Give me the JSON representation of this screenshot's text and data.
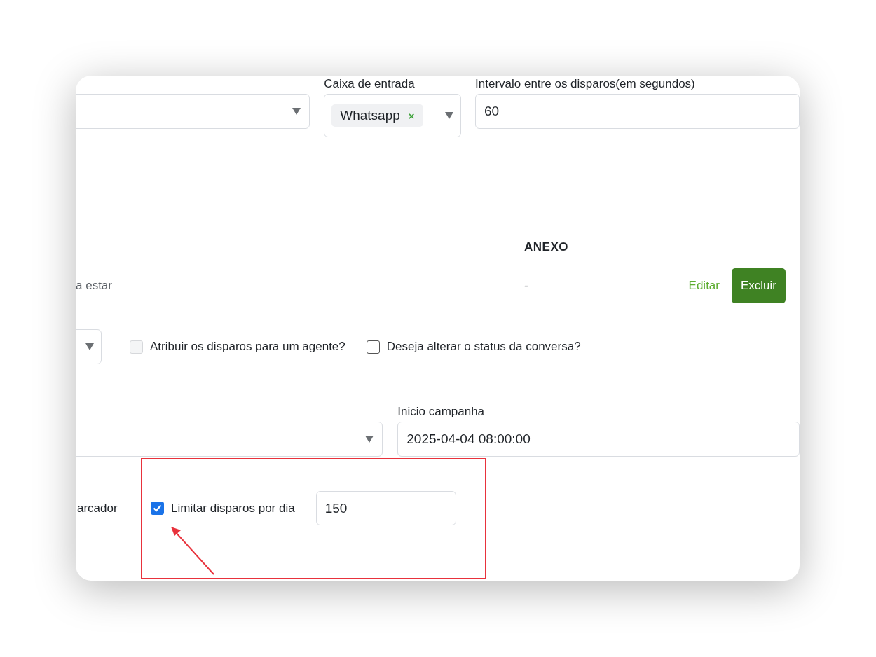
{
  "inbox": {
    "label": "Caixa de entrada",
    "tags": [
      {
        "label": "Whatsapp",
        "remove": "×"
      }
    ]
  },
  "interval": {
    "label": "Intervalo entre os disparos(em segundos)",
    "value": "60"
  },
  "table": {
    "columns": [
      "ANEXO"
    ],
    "rows": [
      {
        "column_1": "a estar",
        "anexo": "-",
        "actions": [
          "Editar",
          "Excluir"
        ]
      }
    ]
  },
  "options": [
    {
      "label": "Atribuir os disparos para um agente?",
      "checked": false,
      "disabled": true
    },
    {
      "label": "Deseja alterar o status da conversa?",
      "checked": false,
      "disabled": false
    }
  ],
  "start": {
    "label": "Inicio campanha",
    "value": "2025-04-04 08:00:00"
  },
  "limit_row": {
    "cut_label": "arcador",
    "option": {
      "label": "Limitar disparos por dia",
      "checked": true
    },
    "value": "150"
  }
}
